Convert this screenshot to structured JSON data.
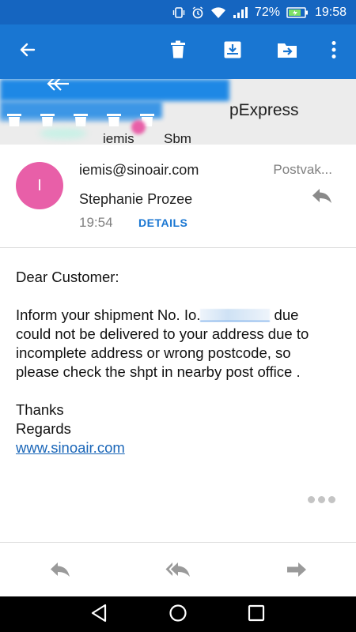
{
  "status_bar": {
    "battery_percent": "72%",
    "clock": "19:58",
    "icons": [
      "vibrate-icon",
      "alarm-icon",
      "wifi-icon",
      "signal-icon",
      "battery-icon"
    ]
  },
  "app_bar": {
    "icons": [
      "back-arrow-icon",
      "delete-icon",
      "archive-icon",
      "move-to-folder-icon",
      "overflow-menu-icon"
    ],
    "color": "#1976d2"
  },
  "subject": {
    "title_fragment": "pExpress",
    "sub_fragment_a": "iemis",
    "sub_fragment_b": "Sbm"
  },
  "message": {
    "avatar_initial": "I",
    "avatar_color": "#e85fa8",
    "from": "iemis@sinoair.com",
    "folder": "Postvak...",
    "to": "Stephanie Prozee",
    "time": "19:54",
    "details_label": "DETAILS"
  },
  "body": {
    "greeting": "Dear Customer:",
    "line1_a": "Inform your shipment No. Io.",
    "line1_b": "due",
    "line2": "could not be delivered to your address due to",
    "line3": "incomplete address or wrong postcode, so",
    "line4": "please check the shpt in nearby post office .",
    "thanks": "Thanks",
    "regards": "Regards",
    "link": "www.sinoair.com",
    "link_color": "#1a66b8"
  },
  "bottom_bar": {
    "icons": [
      "reply-icon",
      "reply-all-icon",
      "forward-icon"
    ]
  },
  "nav_bar": {
    "icons": [
      "back-triangle-icon",
      "home-circle-icon",
      "recents-square-icon"
    ]
  }
}
